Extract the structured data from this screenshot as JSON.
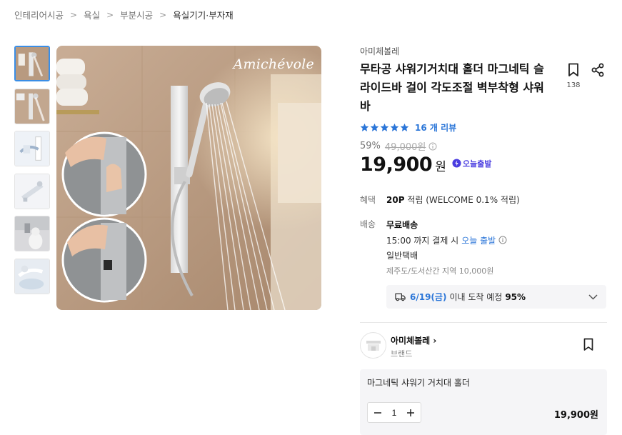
{
  "breadcrumb": [
    "인테리어시공",
    "욕실",
    "부분시공",
    "욕실기기·부자재"
  ],
  "gallery": {
    "thumbnail_count": 6,
    "watermark": "Amichévole"
  },
  "product": {
    "brand": "아미체볼레",
    "title_lines": [
      "무타공 샤워기거치대 홀더 마그네틱 슬",
      "라이드바 걸이 각도조절 벽부착형 샤워",
      "바"
    ],
    "bookmark_count": "138",
    "rating": 5,
    "review_label": "16 개 리뷰",
    "discount": "59%",
    "original_price": "49,000원",
    "price": "19,900",
    "price_unit": "원",
    "today_badge": "오늘출발"
  },
  "benefit": {
    "label": "혜택",
    "points": "20P",
    "text": "적립 (WELCOME 0.1% 적립)"
  },
  "shipping": {
    "label": "배송",
    "fee": "무료배송",
    "cutoff": "15:00 까지 결제 시",
    "today_ship": "오늘 출발",
    "method": "일반택배",
    "extra": "제주도/도서산간 지역 10,000원"
  },
  "eta": {
    "date": "6/19(금)",
    "middle": "이내 도착 예정",
    "percent": "95%"
  },
  "store": {
    "name": "아미체볼레 ›",
    "type": "브랜드"
  },
  "option": {
    "name": "마그네틱 샤워기 거치대 홀더",
    "quantity": "1",
    "price": "19,900원"
  },
  "colors": {
    "accent": "#2b76d8",
    "star": "#2b76d8",
    "badge": "#4a3de0",
    "selected_thumb_border": "#3a8ee6"
  }
}
